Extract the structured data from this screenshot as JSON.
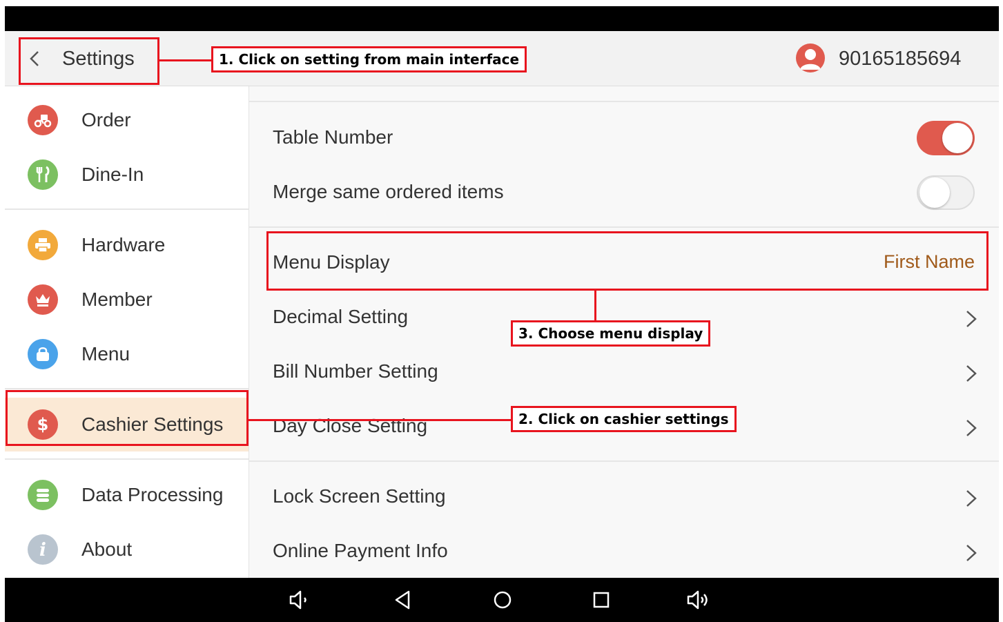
{
  "appbar": {
    "title": "Settings",
    "user_id": "90165185694"
  },
  "sidebar": {
    "items": [
      {
        "label": "Order",
        "icon": "scooter-icon",
        "color": "#e05a4e"
      },
      {
        "label": "Dine-In",
        "icon": "utensils-icon",
        "color": "#7cc061"
      },
      {
        "label": "Hardware",
        "icon": "printer-icon",
        "color": "#f2a93b"
      },
      {
        "label": "Member",
        "icon": "crown-icon",
        "color": "#e05a4e"
      },
      {
        "label": "Menu",
        "icon": "bag-icon",
        "color": "#4aa3ea"
      },
      {
        "label": "Cashier Settings",
        "icon": "dollar-icon",
        "color": "#e05a4e"
      },
      {
        "label": "Data Processing",
        "icon": "database-icon",
        "color": "#7cc061"
      },
      {
        "label": "About",
        "icon": "info-icon",
        "color": "#b9c4cf"
      }
    ]
  },
  "settings": {
    "table_number": {
      "label": "Table Number",
      "enabled": true
    },
    "merge_items": {
      "label": "Merge same ordered items",
      "enabled": false
    },
    "menu_display": {
      "label": "Menu Display",
      "value": "First Name"
    },
    "decimal": {
      "label": "Decimal Setting"
    },
    "bill_number": {
      "label": "Bill Number Setting"
    },
    "day_close": {
      "label": "Day Close Setting"
    },
    "lock_screen": {
      "label": "Lock Screen Setting"
    },
    "online_payment": {
      "label": "Online Payment Info"
    }
  },
  "annotations": {
    "step1": "1. Click on setting from main interface",
    "step2": "2. Click on cashier settings",
    "step3": "3. Choose menu display"
  },
  "colors": {
    "accent": "#e05a4e",
    "annotation": "#e8141e",
    "active_bg": "#fbe9d5",
    "value_text": "#a05a1a"
  }
}
